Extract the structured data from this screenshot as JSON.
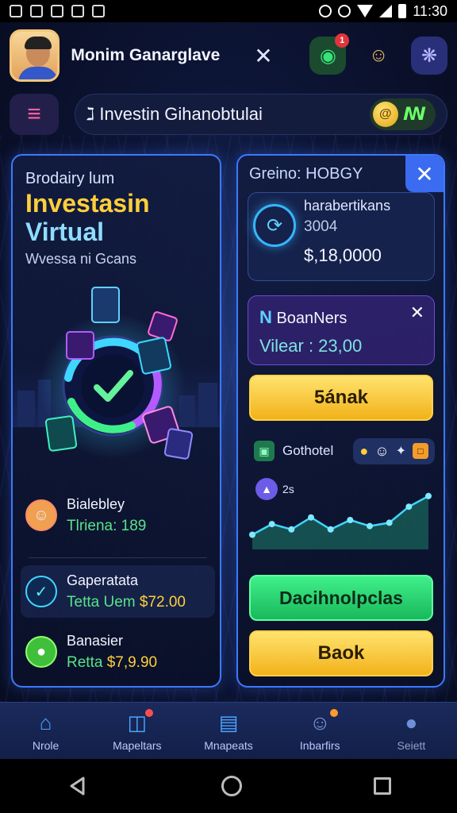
{
  "status_bar": {
    "time": "11:30"
  },
  "header": {
    "user_name": "Monim Ganarglave",
    "close_glyph": "✕",
    "notification_count": "1"
  },
  "search": {
    "text": "ℷ Investin Gihanobtulai",
    "wallet_label": "ꟿ",
    "coin_glyph": "@"
  },
  "left_card": {
    "kicker": "Brodairy lum",
    "title_line1": "Investasin",
    "title_line2": "Virtual",
    "subtitle": "Wvessa ni Gcans",
    "items": [
      {
        "name": "Bialebley",
        "value": "Tlriena: 189",
        "icon": "avatar-icon"
      },
      {
        "name": "Gaperatata",
        "value_prefix": "Tetta Uem",
        "value_amount": "$72.00",
        "icon": "chart-icon"
      },
      {
        "name": "Banasier",
        "value_prefix": "Retta",
        "value_amount": "$7,9.90",
        "icon": "coin-icon"
      }
    ]
  },
  "right_card": {
    "heading": "Greino: HOBGY",
    "stat": {
      "label": "harabertikans",
      "number": "3004",
      "amount": "$,18,0000"
    },
    "pass": {
      "letter": "N",
      "title": "BoanNers",
      "value": "Vilear : 23,00"
    },
    "buttons": {
      "primary": "5ának",
      "green": "Dacihnolpclas",
      "back": "Baok"
    },
    "goals": {
      "label": "Gothotel"
    },
    "chart_label": "2s"
  },
  "chart_data": {
    "type": "line",
    "values": [
      22,
      38,
      30,
      48,
      30,
      44,
      35,
      40,
      64,
      80
    ],
    "xlabel": "",
    "ylabel": ""
  },
  "bottom_nav": [
    {
      "label": "Nrole",
      "icon": "home-icon"
    },
    {
      "label": "Mapeltars",
      "icon": "cube-icon"
    },
    {
      "label": "Mnapeats",
      "icon": "notepad-icon"
    },
    {
      "label": "Inbarfirs",
      "icon": "people-icon"
    },
    {
      "label": "Seiett",
      "icon": "chat-icon"
    }
  ],
  "colors": {
    "accent_blue": "#3c79ff",
    "gold": "#ffcf3a",
    "green": "#3ff08a",
    "background": "#0a0f24"
  }
}
